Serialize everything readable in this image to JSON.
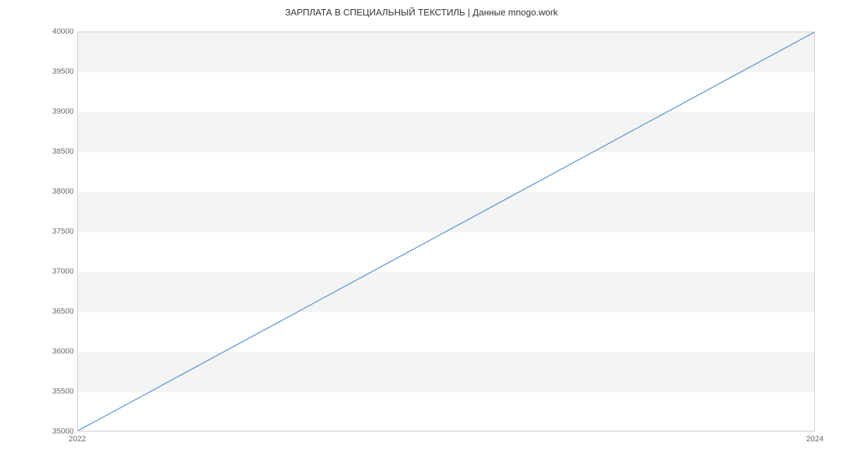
{
  "chart_data": {
    "type": "line",
    "title": "ЗАРПЛАТА В СПЕЦИАЛЬНЫЙ ТЕКСТИЛЬ | Данные mnogo.work",
    "xlabel": "",
    "ylabel": "",
    "x_ticks": [
      "2022",
      "2024"
    ],
    "y_ticks": [
      35000,
      35500,
      36000,
      36500,
      37000,
      37500,
      38000,
      38500,
      39000,
      39500,
      40000
    ],
    "ylim": [
      35000,
      40000
    ],
    "x": [
      2022,
      2024
    ],
    "values": [
      35000,
      40000
    ],
    "line_color": "#6a9ed9",
    "grid_band_color": "#f4f4f4"
  }
}
